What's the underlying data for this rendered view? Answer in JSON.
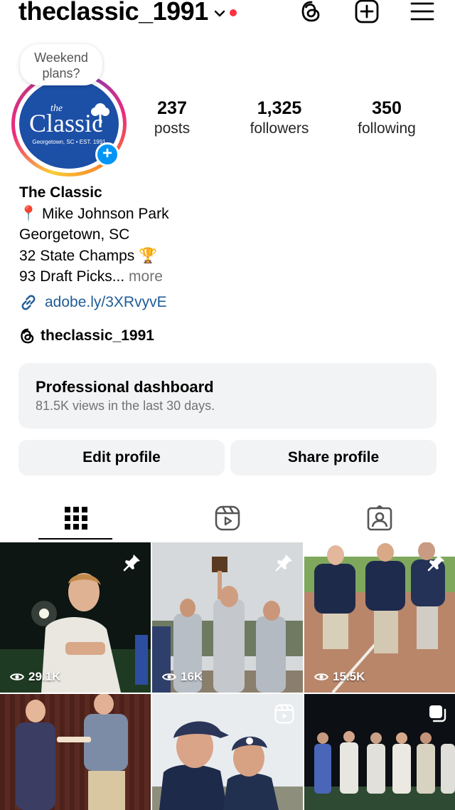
{
  "header": {
    "username": "theclassic_1991"
  },
  "profile": {
    "note": "Weekend plans?",
    "avatar_logo": {
      "the": "the",
      "main": "Classic",
      "sub": "Georgetown, SC • EST. 1991"
    },
    "stats": [
      {
        "value": "237",
        "label": "posts"
      },
      {
        "value": "1,325",
        "label": "followers"
      },
      {
        "value": "350",
        "label": "following"
      }
    ]
  },
  "bio": {
    "name": "The Classic",
    "line1": "📍 Mike Johnson Park",
    "line2": "Georgetown, SC",
    "line3": "32 State Champs 🏆",
    "line4": "93 Draft Picks...",
    "more": " more",
    "link": "adobe.ly/3XRvyvE",
    "threads_handle": "theclassic_1991"
  },
  "dashboard": {
    "title": "Professional dashboard",
    "subtitle": "81.5K views in the last 30 days."
  },
  "buttons": {
    "edit": "Edit profile",
    "share": "Share profile"
  },
  "grid": {
    "views": [
      "29.1K",
      "16K",
      "15.5K"
    ]
  },
  "colors": {
    "accent_blue": "#0095f6",
    "notification_dot": "#ff3040",
    "button_bg": "#f2f3f5",
    "link": "#1f5c99"
  }
}
